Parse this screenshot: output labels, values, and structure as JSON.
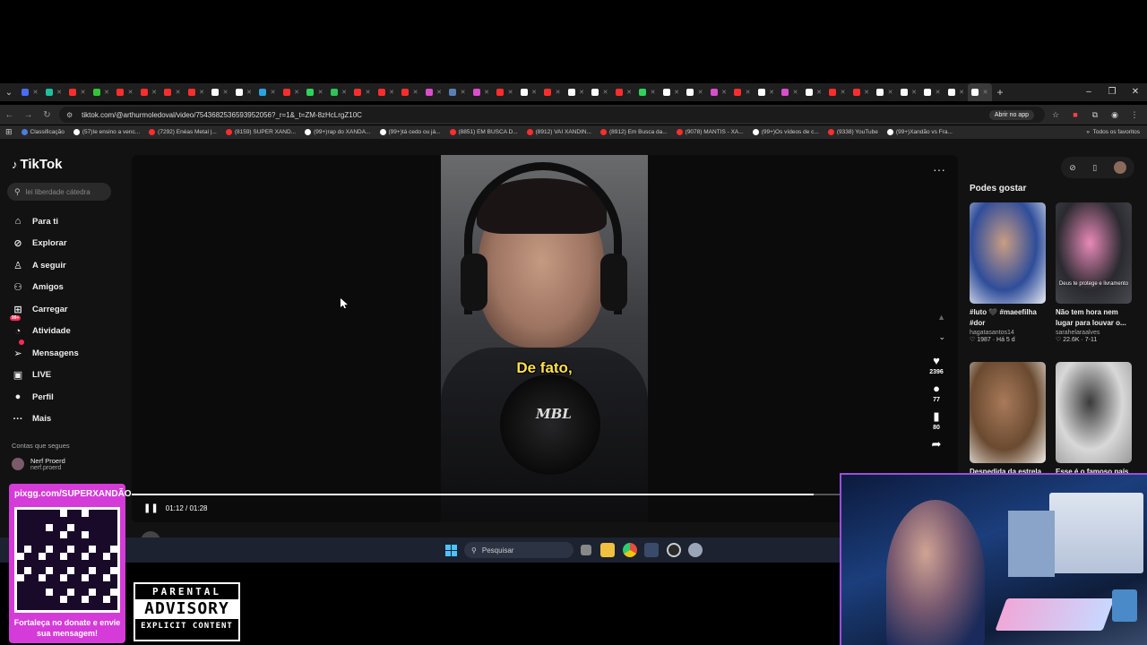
{
  "browser": {
    "url": "tiktok.com/@arthurmoledoval/video/7543682536593952056?_r=1&_t=ZM-8zHcLrgZ10C",
    "open_app": "Abrir no app",
    "all_favorites": "Todos os favoritos",
    "bookmarks": [
      {
        "label": "Classificação",
        "color": "#4a7fe0"
      },
      {
        "label": "(57)Ie ensino a venc...",
        "color": "#ffffff"
      },
      {
        "label": "(7292) Enéas Metal |...",
        "color": "#ff2e2e"
      },
      {
        "label": "(8159) SUPER XAND...",
        "color": "#ff2e2e"
      },
      {
        "label": "(99+)rap do XANDÃ...",
        "color": "#ffffff"
      },
      {
        "label": "(99+)tá cedo ou já...",
        "color": "#ffffff"
      },
      {
        "label": "(8851) EM BUSCA D...",
        "color": "#ff2e2e"
      },
      {
        "label": "(8912) VAI XANDIN...",
        "color": "#ff2e2e"
      },
      {
        "label": "(8912) Em Busca da...",
        "color": "#ff2e2e"
      },
      {
        "label": "(9078) MANTIS - XA...",
        "color": "#ff2e2e"
      },
      {
        "label": "(99+)Os vídeos de c...",
        "color": "#ffffff"
      },
      {
        "label": "(9338) YouTube",
        "color": "#ff2e2e"
      },
      {
        "label": "(99+)Xandão vs Fra...",
        "color": "#ffffff"
      }
    ],
    "tab_colors": [
      "#4a6cf7",
      "#1fbf9f",
      "#ff2e2e",
      "#35c435",
      "#ff2e2e",
      "#ff2e2e",
      "#ff2e2e",
      "#ff2e2e",
      "#ffffff",
      "#ffffff",
      "#2aa3e0",
      "#ff2e2e",
      "#2fd35a",
      "#2fc35a",
      "#ff2e2e",
      "#ff2e2e",
      "#ff2e2e",
      "#d94ecb",
      "#5a7fb5",
      "#d94ecb",
      "#ff2e2e",
      "#ffffff",
      "#ff2e2e",
      "#ffffff",
      "#ffffff",
      "#ff2e2e",
      "#2fd35a",
      "#ffffff",
      "#ffffff",
      "#d94ecb",
      "#ff2e2e",
      "#ffffff",
      "#d94ecb",
      "#ffffff",
      "#ff2e2e",
      "#ff2e2e",
      "#ffffff",
      "#ffffff",
      "#ffffff",
      "#ffffff",
      "#ffffff"
    ]
  },
  "tiktok": {
    "logo": "TikTok",
    "search_placeholder": "lei liberdade cátedra",
    "nav": [
      {
        "label": "Para ti",
        "icon": "home-icon",
        "glyph": "⌂"
      },
      {
        "label": "Explorar",
        "icon": "compass-icon",
        "glyph": "⊘"
      },
      {
        "label": "A seguir",
        "icon": "person-plus-icon",
        "glyph": "♙"
      },
      {
        "label": "Amigos",
        "icon": "friends-icon",
        "glyph": "⚇"
      },
      {
        "label": "Carregar",
        "icon": "upload-icon",
        "glyph": "⊞"
      },
      {
        "label": "Atividade",
        "icon": "bell-icon",
        "glyph": "◔",
        "badge": "99+"
      },
      {
        "label": "Mensagens",
        "icon": "send-icon",
        "glyph": "➢",
        "badge": ""
      },
      {
        "label": "LIVE",
        "icon": "live-icon",
        "glyph": "▣"
      },
      {
        "label": "Perfil",
        "icon": "avatar-icon",
        "glyph": "●"
      },
      {
        "label": "Mais",
        "icon": "more-icon",
        "glyph": "···"
      }
    ],
    "following_title": "Contas que segues",
    "following": [
      {
        "name": "Nerf Proerd",
        "handle": "nerf.proerd"
      }
    ],
    "video": {
      "caption": "De fato,",
      "mic_logo": "MBL",
      "time": "01:12 / 01:28",
      "progress": 0.825,
      "likes": "2396",
      "comments": "77",
      "saves": "80",
      "author": "arthurmoledoval"
    },
    "recommend_title": "Podes gostar",
    "recommendations": [
      {
        "caption": "#luto 🖤 #maeefilha #dor",
        "user": "hagatasantos14",
        "meta": "♡ 1987 · Há 5 d",
        "colors": [
          "#e8ecf2",
          "#c99d84",
          "#2f4d9a"
        ]
      },
      {
        "caption": "Não tem hora nem lugar para louvar o...",
        "user": "sarahelaraalves",
        "meta": "♡ 22.6K · 7-11",
        "colors": [
          "#4a4a52",
          "#e88ab8",
          "#2a2a30"
        ]
      },
      {
        "caption": "Despedida da estrela",
        "user": "",
        "meta": "",
        "colors": [
          "#f0ece6",
          "#a87a5a",
          "#6a4a30"
        ]
      },
      {
        "caption": "Esse é o famoso país",
        "user": "",
        "meta": "",
        "colors": [
          "#9a9a9a",
          "#3a3a3a",
          "#d8d8d8"
        ]
      }
    ],
    "thumb_overlay": "Deus te protege e livramento"
  },
  "taskbar": {
    "search_placeholder": "Pesquisar"
  },
  "overlay": {
    "donate_url": "pixgg.com/SUPERXANDÃO",
    "donate_text": "Fortaleça no donate e envie sua mensagem!",
    "advisory_top": "PARENTAL",
    "advisory_main": "ADVISORY",
    "advisory_bottom": "EXPLICIT CONTENT"
  }
}
